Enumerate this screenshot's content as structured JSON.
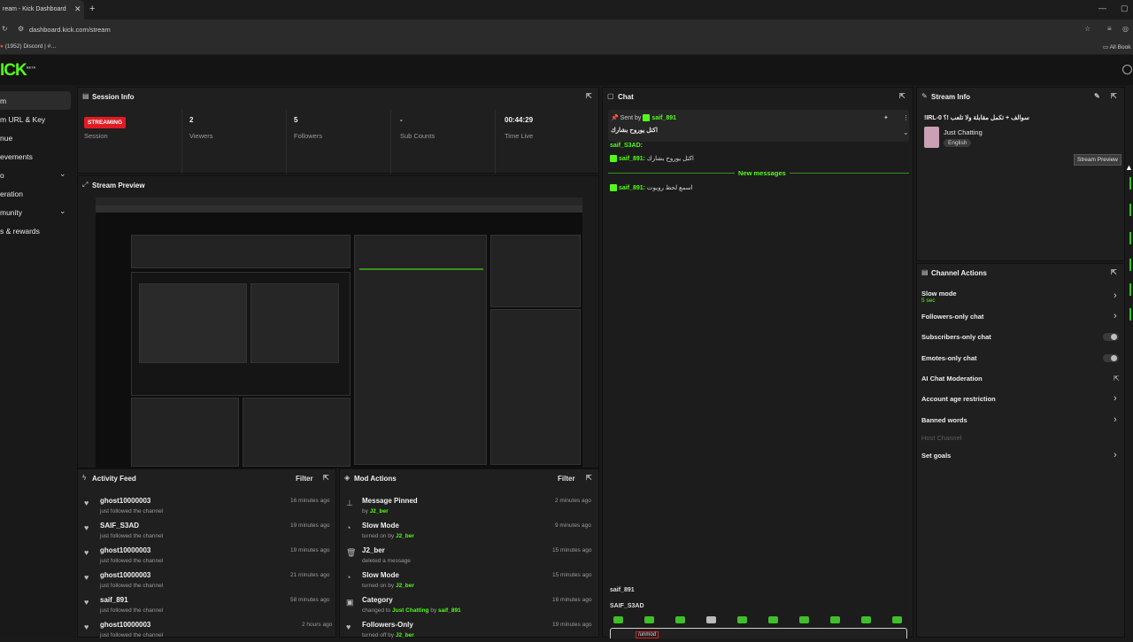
{
  "browser": {
    "tab_title": "ream - Kick Dashboard",
    "url": "dashboard.kick.com/stream",
    "bookmark_discord": "(1952) Discord | #…",
    "all_bookmarks": "All Book"
  },
  "app": {
    "logo": "ICK",
    "logo_beta": "BETA"
  },
  "sidebar": {
    "items": [
      {
        "label": "m"
      },
      {
        "label": "m URL & Key"
      },
      {
        "label": "nue"
      },
      {
        "label": "evements"
      },
      {
        "label": "o"
      },
      {
        "label": "eration"
      },
      {
        "label": "munity"
      },
      {
        "label": "s & rewards"
      }
    ]
  },
  "session": {
    "title": "Session Info",
    "status": "STREAMING",
    "stats": [
      {
        "value": "",
        "label": "Session"
      },
      {
        "value": "2",
        "label": "Viewers"
      },
      {
        "value": "5",
        "label": "Followers"
      },
      {
        "value": "-",
        "label": "Sub Counts"
      },
      {
        "value": "00:44:29",
        "label": "Time Live"
      }
    ]
  },
  "preview": {
    "title": "Stream Preview"
  },
  "chat": {
    "title": "Chat",
    "pinned_sender_prefix": "Sent by",
    "pinned_sender": "saif_891",
    "pinned_text": "اكتل يوروح بشارك",
    "partial_user": "saif_S3AD:",
    "messages": [
      {
        "user": "saif_891:",
        "text": "اكتل يوروح بشارك"
      },
      {
        "user": "saif_891:",
        "text": "اسمع لحظ رويوت"
      }
    ],
    "new_messages": "New messages",
    "bottom_user_1": "saif_891",
    "bottom_user_2": "SAIF_S3AD",
    "input_tag": "/unmod"
  },
  "stream_info": {
    "title": "Stream Info",
    "stream_title": "!IRL-0 سوالف + تكمل مقابلة ولا تلعب !؟",
    "category": "Just Chatting",
    "language": "English",
    "tooltip": "Stream Preview"
  },
  "channel_actions": {
    "title": "Channel Actions",
    "slow_mode": "Slow mode",
    "slow_mode_value": "5 sec",
    "followers_only": "Followers-only chat",
    "subscribers_only": "Subscribers-only chat",
    "emotes_only": "Emotes-only chat",
    "ai_moderation": "AI Chat Moderation",
    "account_age": "Account age restriction",
    "banned_words": "Banned words",
    "host_channel": "Host Channel",
    "set_goals": "Set goals"
  },
  "activity": {
    "title": "Activity Feed",
    "filter": "Filter",
    "items": [
      {
        "name": "ghost10000003",
        "action": "just followed the channel",
        "time": "16 minutes ago"
      },
      {
        "name": "SAIF_S3AD",
        "action": "just followed the channel",
        "time": "19 minutes ago"
      },
      {
        "name": "ghost10000003",
        "action": "just followed the channel",
        "time": "19 minutes ago"
      },
      {
        "name": "ghost10000003",
        "action": "just followed the channel",
        "time": "21 minutes ago"
      },
      {
        "name": "saif_891",
        "action": "just followed the channel",
        "time": "58 minutes ago"
      },
      {
        "name": "ghost10000003",
        "action": "just followed the channel",
        "time": "2 hours ago"
      }
    ]
  },
  "mod": {
    "title": "Mod Actions",
    "filter": "Filter",
    "items": [
      {
        "name": "Message Pinned",
        "prefix": "by",
        "user": "J2_ber",
        "suffix": "",
        "user2": "",
        "time": "2 minutes ago"
      },
      {
        "name": "Slow Mode",
        "prefix": "turned on by",
        "user": "J2_ber",
        "suffix": "",
        "user2": "",
        "time": "9 minutes ago"
      },
      {
        "name": "J2_ber",
        "prefix": "deleted a message",
        "user": "",
        "suffix": "",
        "user2": "",
        "time": "15 minutes ago"
      },
      {
        "name": "Slow Mode",
        "prefix": "turned on by",
        "user": "J2_ber",
        "suffix": "",
        "user2": "",
        "time": "15 minutes ago"
      },
      {
        "name": "Category",
        "prefix": "changed to",
        "user": "Just Chatting",
        "suffix": "by",
        "user2": "saif_891",
        "time": "16 minutes ago"
      },
      {
        "name": "Followers-Only",
        "prefix": "turned off by",
        "user": "J2_ber",
        "suffix": "",
        "user2": "",
        "time": "19 minutes ago"
      }
    ]
  }
}
